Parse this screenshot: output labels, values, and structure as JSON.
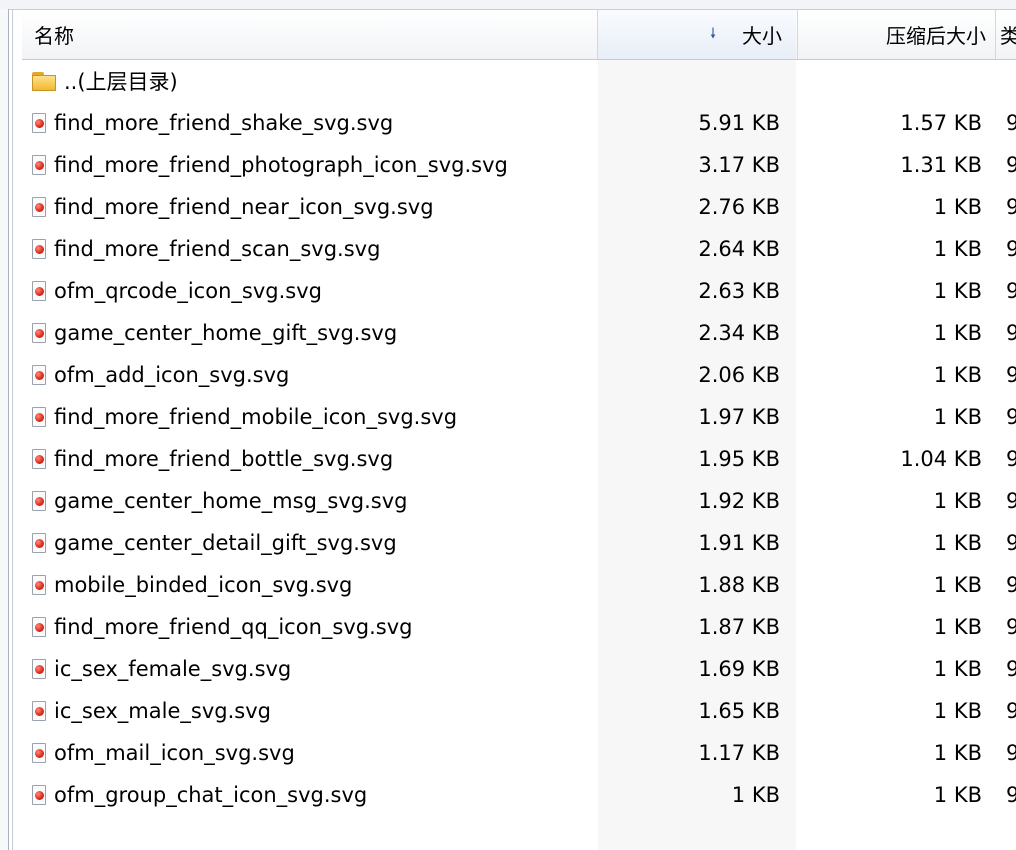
{
  "columns": {
    "name": "名称",
    "size": "大小",
    "compressed": "压缩后大小",
    "extra": "类"
  },
  "sort_indicator": "🠗",
  "parent_dir": {
    "name": "..(上层目录)",
    "icon": "folder-icon"
  },
  "files": [
    {
      "name": "find_more_friend_shake_svg.svg",
      "size": "5.91 KB",
      "compressed": "1.57 KB",
      "extra": "9"
    },
    {
      "name": "find_more_friend_photograph_icon_svg.svg",
      "size": "3.17 KB",
      "compressed": "1.31 KB",
      "extra": "9"
    },
    {
      "name": "find_more_friend_near_icon_svg.svg",
      "size": "2.76 KB",
      "compressed": "1 KB",
      "extra": "9"
    },
    {
      "name": "find_more_friend_scan_svg.svg",
      "size": "2.64 KB",
      "compressed": "1 KB",
      "extra": "9"
    },
    {
      "name": "ofm_qrcode_icon_svg.svg",
      "size": "2.63 KB",
      "compressed": "1 KB",
      "extra": "9"
    },
    {
      "name": "game_center_home_gift_svg.svg",
      "size": "2.34 KB",
      "compressed": "1 KB",
      "extra": "9"
    },
    {
      "name": "ofm_add_icon_svg.svg",
      "size": "2.06 KB",
      "compressed": "1 KB",
      "extra": "9"
    },
    {
      "name": "find_more_friend_mobile_icon_svg.svg",
      "size": "1.97 KB",
      "compressed": "1 KB",
      "extra": "9"
    },
    {
      "name": "find_more_friend_bottle_svg.svg",
      "size": "1.95 KB",
      "compressed": "1.04 KB",
      "extra": "9"
    },
    {
      "name": "game_center_home_msg_svg.svg",
      "size": "1.92 KB",
      "compressed": "1 KB",
      "extra": "9"
    },
    {
      "name": "game_center_detail_gift_svg.svg",
      "size": "1.91 KB",
      "compressed": "1 KB",
      "extra": "9"
    },
    {
      "name": "mobile_binded_icon_svg.svg",
      "size": "1.88 KB",
      "compressed": "1 KB",
      "extra": "9"
    },
    {
      "name": "find_more_friend_qq_icon_svg.svg",
      "size": "1.87 KB",
      "compressed": "1 KB",
      "extra": "9"
    },
    {
      "name": "ic_sex_female_svg.svg",
      "size": "1.69 KB",
      "compressed": "1 KB",
      "extra": "9"
    },
    {
      "name": "ic_sex_male_svg.svg",
      "size": "1.65 KB",
      "compressed": "1 KB",
      "extra": "9"
    },
    {
      "name": "ofm_mail_icon_svg.svg",
      "size": "1.17 KB",
      "compressed": "1 KB",
      "extra": "9"
    },
    {
      "name": "ofm_group_chat_icon_svg.svg",
      "size": "1 KB",
      "compressed": "1 KB",
      "extra": "9"
    }
  ],
  "file_icon": "svg-file-icon"
}
